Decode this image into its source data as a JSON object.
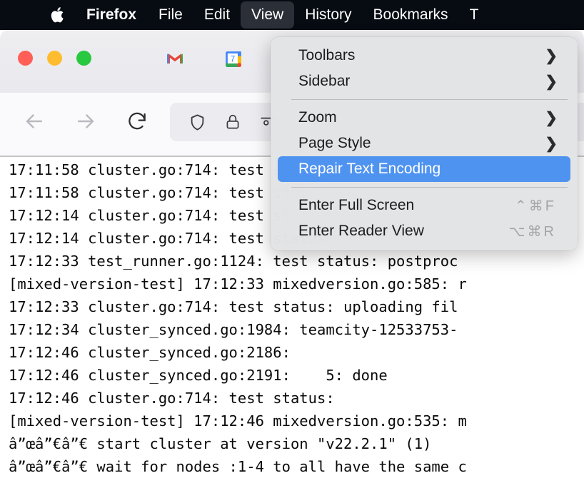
{
  "menubar": {
    "apple_icon": "apple-logo-icon",
    "items": [
      {
        "label": "Firefox",
        "bold": true,
        "active": false
      },
      {
        "label": "File",
        "bold": false,
        "active": false
      },
      {
        "label": "Edit",
        "bold": false,
        "active": false
      },
      {
        "label": "View",
        "bold": false,
        "active": true
      },
      {
        "label": "History",
        "bold": false,
        "active": false
      },
      {
        "label": "Bookmarks",
        "bold": false,
        "active": false
      },
      {
        "label": "T",
        "bold": false,
        "active": false
      }
    ]
  },
  "window": {
    "traffic_lights": [
      "close",
      "minimize",
      "zoom"
    ],
    "favicons": [
      "gmail-favicon",
      "google-calendar-favicon"
    ],
    "calendar_day": "7",
    "nav": {
      "back": "back-arrow-icon",
      "forward": "forward-arrow-icon",
      "reload": "reload-icon",
      "shield": "shield-icon",
      "lock": "lock-icon",
      "settings": "settings-slider-icon"
    }
  },
  "view_menu": {
    "items": [
      {
        "label": "Toolbars",
        "submenu": true,
        "shortcut": "",
        "highlight": false
      },
      {
        "label": "Sidebar",
        "submenu": true,
        "shortcut": "",
        "highlight": false
      },
      {
        "type": "separator"
      },
      {
        "label": "Zoom",
        "submenu": true,
        "shortcut": "",
        "highlight": false
      },
      {
        "label": "Page Style",
        "submenu": true,
        "shortcut": "",
        "highlight": false
      },
      {
        "label": "Repair Text Encoding",
        "submenu": false,
        "shortcut": "",
        "highlight": true
      },
      {
        "type": "separator"
      },
      {
        "label": "Enter Full Screen",
        "submenu": false,
        "shortcut": "⌃⌘F",
        "highlight": false
      },
      {
        "label": "Enter Reader View",
        "submenu": false,
        "shortcut": "⌥⌘R",
        "highlight": false
      }
    ],
    "colors": {
      "highlight": "#4f93f0",
      "background": "#e2e3e4",
      "shortcut_text": "#a6a6a8"
    }
  },
  "log": {
    "lines": [
      "17:11:58 cluster.go:714: test status: uploading fil",
      "17:11:58 cluster.go:714: test status:",
      "17:12:14 cluster.go:714: test status: uploading fil",
      "17:12:14 cluster.go:714: test status:",
      "17:12:33 test_runner.go:1124: test status: postproc",
      "[mixed-version-test] 17:12:33 mixedversion.go:585: r",
      "17:12:33 cluster.go:714: test status: uploading fil",
      "17:12:34 cluster_synced.go:1984: teamcity-12533753-",
      "17:12:46 cluster_synced.go:2186:",
      "17:12:46 cluster_synced.go:2191:    5: done",
      "17:12:46 cluster.go:714: test status:",
      "[mixed-version-test] 17:12:46 mixedversion.go:535: m",
      "â”œâ”€â”€ start cluster at version \"v22.2.1\" (1)",
      "â”œâ”€â”€ wait for nodes :1-4 to all have the same c"
    ]
  }
}
